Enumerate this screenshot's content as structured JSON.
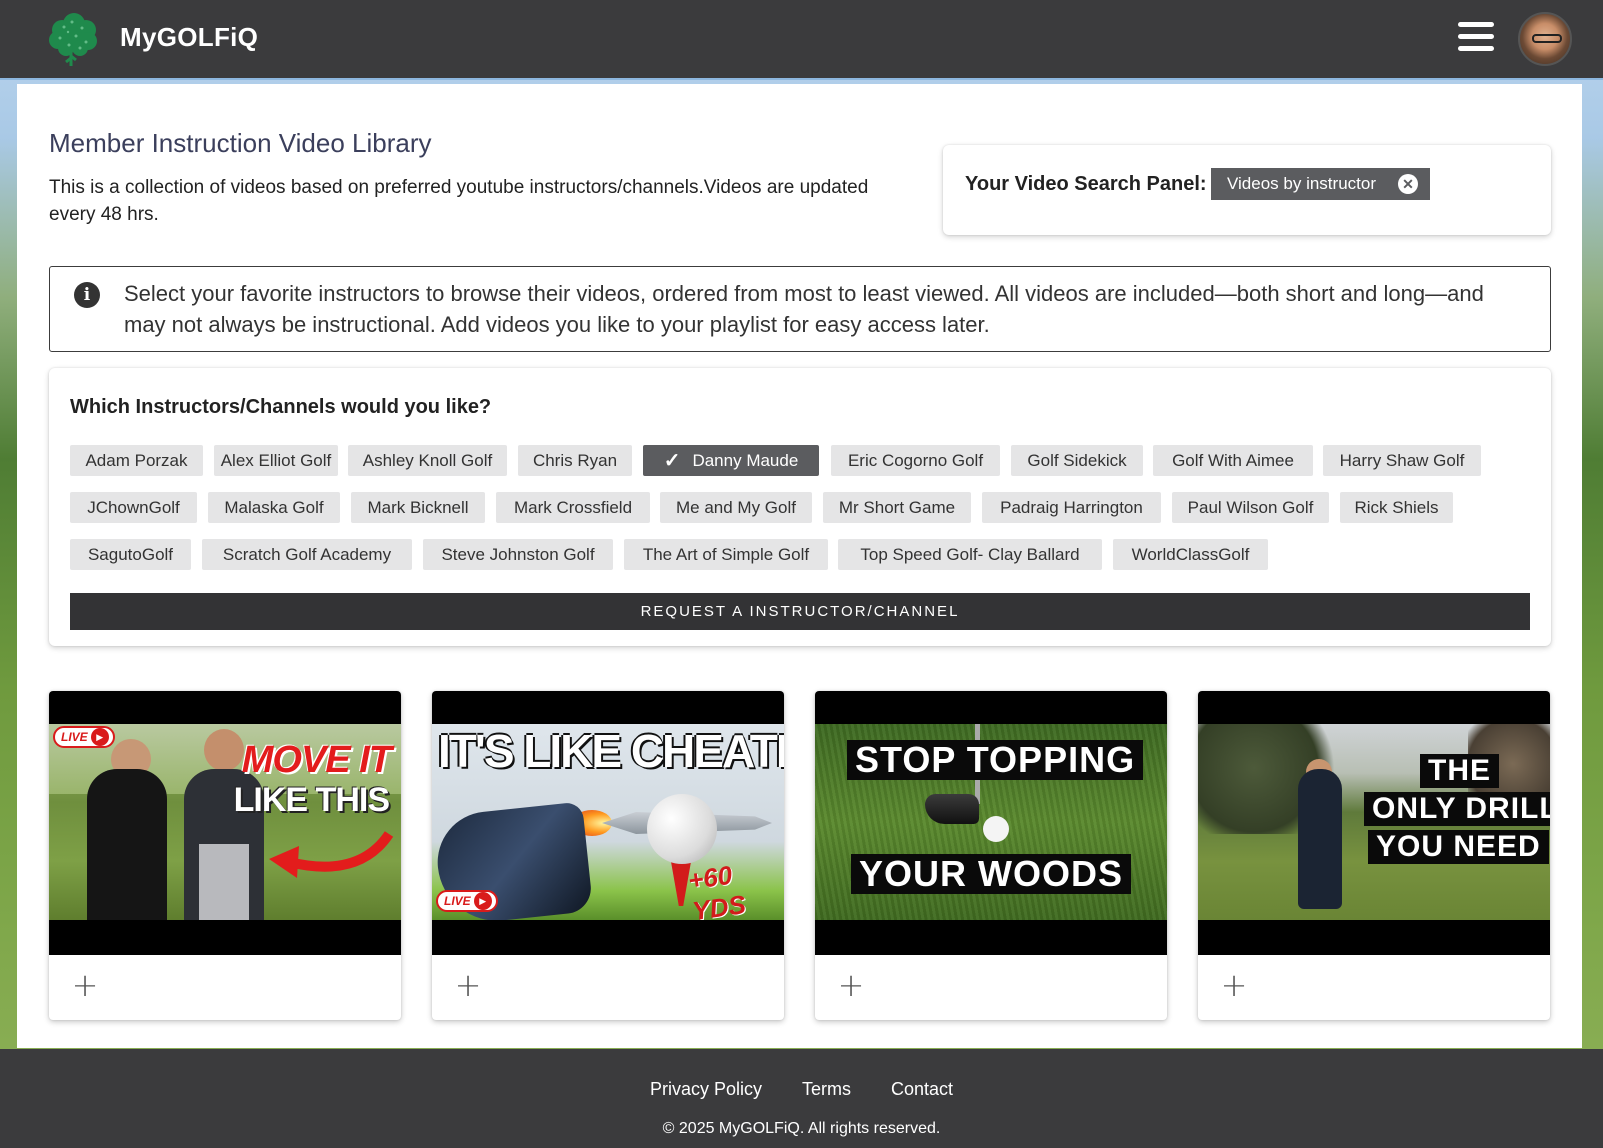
{
  "header": {
    "brand": "MyGOLFiQ",
    "menu_icon": "hamburger-menu-icon",
    "avatar": "user-avatar"
  },
  "main": {
    "title": "Member Instruction Video Library",
    "description": "This is a collection of videos based on preferred youtube instructors/channels.Videos are updated every 48 hrs.",
    "search_panel": {
      "label": "Your Video Search Panel:",
      "active_filter": "Videos by instructor",
      "close_icon": "close-circle-icon"
    },
    "info": {
      "icon": "info-icon",
      "text": "Select your favorite instructors to browse their videos, ordered from most to least viewed. All videos are included—both short and long—and may not always be instructional. Add videos you like to your playlist for easy access later."
    },
    "instructors": {
      "question": "Which Instructors/Channels would you like?",
      "selected": "Danny Maude",
      "chips": [
        "Adam Porzak",
        "Alex Elliot Golf",
        "Ashley Knoll Golf",
        "Chris Ryan",
        "Danny Maude",
        "Eric Cogorno Golf",
        "Golf Sidekick",
        "Golf With Aimee",
        "Harry Shaw Golf",
        "JChownGolf",
        "Malaska Golf",
        "Mark Bicknell",
        "Mark Crossfield",
        "Me and My Golf",
        "Mr Short Game",
        "Padraig Harrington",
        "Paul Wilson Golf",
        "Rick Shiels",
        "SagutoGolf",
        "Scratch Golf Academy",
        "Steve Johnston Golf",
        "The Art of Simple Golf",
        "Top Speed Golf- Clay Ballard",
        "WorldClassGolf"
      ],
      "request_button": "REQUEST A INSTRUCTOR/CHANNEL"
    },
    "videos": [
      {
        "thumb_text_1": "MOVE IT",
        "thumb_text_2": "LIKE THIS",
        "badge": "LIVE",
        "add_icon": "plus-icon"
      },
      {
        "thumb_text_1": "IT'S LIKE CHEATING",
        "thumb_text_2": "+60 YDS",
        "badge": "LIVE",
        "add_icon": "plus-icon"
      },
      {
        "thumb_text_1": "STOP TOPPING",
        "thumb_text_2": "YOUR WOODS",
        "add_icon": "plus-icon"
      },
      {
        "thumb_text_1": "THE",
        "thumb_text_2": "ONLY DRILL",
        "thumb_text_3": "YOU NEED",
        "add_icon": "plus-icon"
      }
    ]
  },
  "footer": {
    "links": [
      "Privacy Policy",
      "Terms",
      "Contact"
    ],
    "copyright": "© 2025 MyGOLFiQ. All rights reserved."
  },
  "colors": {
    "header_bg": "#3b3b3d",
    "chip_bg": "#e5e5e6",
    "chip_selected_bg": "#5b5c5f",
    "button_bg": "#333335"
  }
}
